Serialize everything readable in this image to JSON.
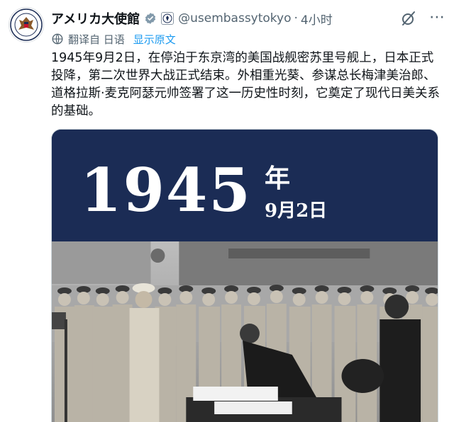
{
  "author": {
    "display_name": "アメリカ大使館",
    "handle": "@usembassytokyo",
    "separator": "·",
    "time": "4小时"
  },
  "translation": {
    "label": "翻译自 日语",
    "show_original": "显示原文"
  },
  "tweet": {
    "text": "1945年9月2日，在停泊于东京湾的美国战舰密苏里号舰上，日本正式投降，第二次世界大战正式结束。外相重光葵、参谋总长梅津美治郎、道格拉斯·麦克阿瑟元帅签署了这一历史性时刻，它奠定了现代日美关系的基础。"
  },
  "media": {
    "year": "1945",
    "year_suffix": "年",
    "date": "9月2日"
  },
  "icons": {
    "verified": "verified-badge-icon",
    "affiliate": "affiliate-seal-icon",
    "grok": "grok-icon",
    "more": "more-icon",
    "translate": "globe-icon"
  },
  "colors": {
    "link": "#1d9bf0",
    "secondary": "#536471",
    "banner": "#1b2c55"
  }
}
